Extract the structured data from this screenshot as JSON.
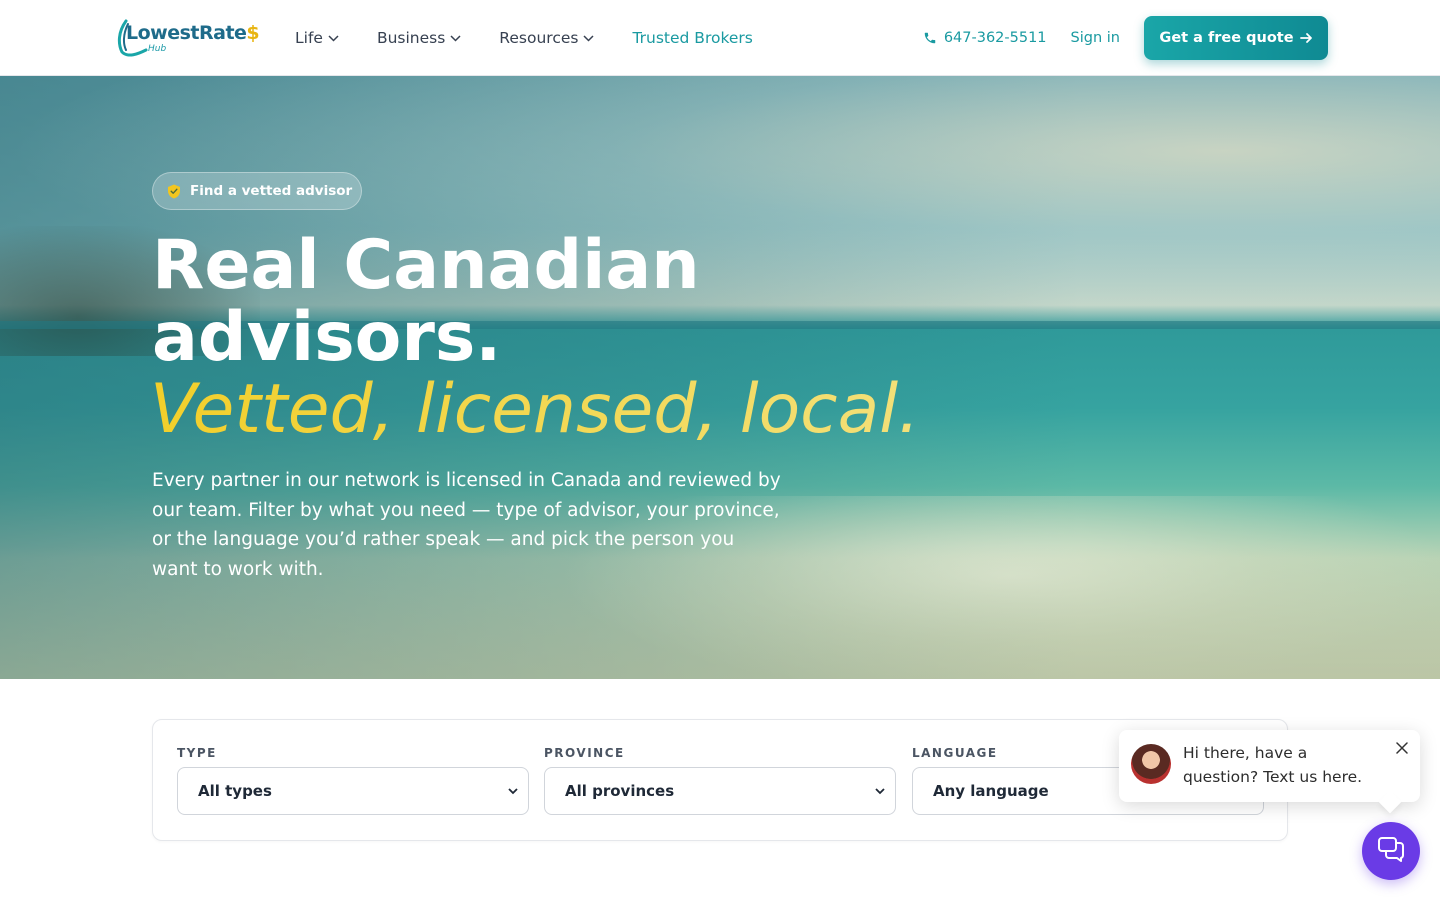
{
  "header": {
    "logo": {
      "word": "LowestRate",
      "dollar": "$",
      "sub": "Hub"
    },
    "nav": [
      {
        "label": "Life",
        "has_dropdown": true
      },
      {
        "label": "Business",
        "has_dropdown": true
      },
      {
        "label": "Resources",
        "has_dropdown": true
      },
      {
        "label": "Trusted Brokers",
        "has_dropdown": false,
        "active": true
      }
    ],
    "phone": "647-362-5511",
    "signin": "Sign in",
    "cta": "Get a free quote"
  },
  "hero": {
    "badge": "Find a vetted advisor",
    "title_line1": "Real Canadian",
    "title_line2": "advisors.",
    "title_em": "Vetted, licensed, local.",
    "lead": "Every partner in our network is licensed in Canada and reviewed by our team. Filter by what you need — type of advisor, your province, or the language you’d rather speak — and pick the person you want to work with."
  },
  "filters": [
    {
      "label": "TYPE",
      "value": "All types"
    },
    {
      "label": "PROVINCE",
      "value": "All provinces"
    },
    {
      "label": "LANGUAGE",
      "value": "Any language"
    }
  ],
  "chat": {
    "message": "Hi there, have a question? Text us here."
  },
  "colors": {
    "accent": "#1a9aa1",
    "highlight": "#f2d13a",
    "chat": "#6a3be6"
  }
}
